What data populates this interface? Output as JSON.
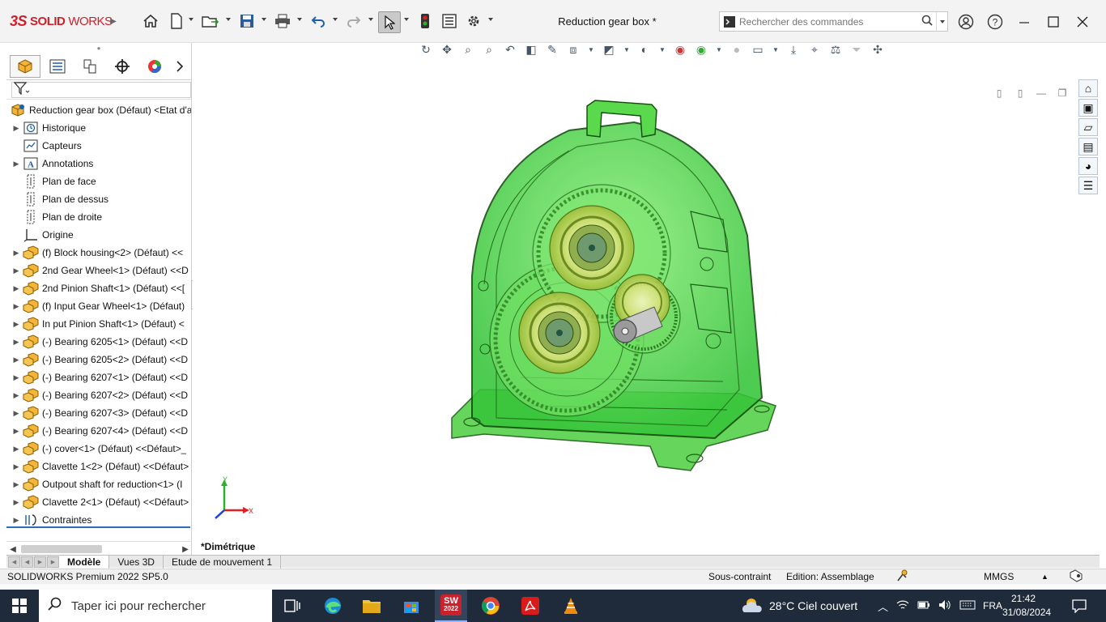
{
  "app": {
    "brand_prefix": "3S",
    "brand_solid": "SOLID",
    "brand_works": "WORKS",
    "document_title": "Reduction gear box *"
  },
  "search": {
    "placeholder": "Rechercher des commandes"
  },
  "toolbar_icons": [
    "home-icon",
    "new-document-icon",
    "open-icon",
    "save-icon",
    "print-icon",
    "undo-icon",
    "redo-icon",
    "select-icon",
    "rebuild-icon",
    "file-properties-icon",
    "options-icon"
  ],
  "feature_tree": {
    "root": "Reduction gear box (Défaut) <Etat d'a",
    "items": [
      {
        "label": "Historique",
        "icon": "history-icon",
        "expandable": true
      },
      {
        "label": "Capteurs",
        "icon": "sensor-icon",
        "expandable": false
      },
      {
        "label": "Annotations",
        "icon": "annotation-icon",
        "expandable": true
      },
      {
        "label": "Plan de face",
        "icon": "plane-icon",
        "expandable": false
      },
      {
        "label": "Plan de dessus",
        "icon": "plane-icon",
        "expandable": false
      },
      {
        "label": "Plan de droite",
        "icon": "plane-icon",
        "expandable": false
      },
      {
        "label": "Origine",
        "icon": "origin-icon",
        "expandable": false
      },
      {
        "label": "(f) Block housing<2> (Défaut) <<",
        "icon": "part-icon",
        "expandable": true
      },
      {
        "label": "2nd Gear Wheel<1> (Défaut) <<D",
        "icon": "part-icon",
        "expandable": true
      },
      {
        "label": "2nd Pinion Shaft<1> (Défaut) <<[",
        "icon": "part-icon",
        "expandable": true
      },
      {
        "label": "(f) Input Gear Wheel<1> (Défaut)",
        "icon": "part-icon",
        "expandable": true
      },
      {
        "label": "In put Pinion Shaft<1> (Défaut) <",
        "icon": "part-icon",
        "expandable": true
      },
      {
        "label": "(-) Bearing 6205<1> (Défaut) <<D",
        "icon": "part-icon",
        "expandable": true
      },
      {
        "label": "(-) Bearing 6205<2> (Défaut) <<D",
        "icon": "part-icon",
        "expandable": true
      },
      {
        "label": "(-) Bearing 6207<1> (Défaut) <<D",
        "icon": "part-icon",
        "expandable": true
      },
      {
        "label": "(-) Bearing 6207<2> (Défaut) <<D",
        "icon": "part-icon",
        "expandable": true
      },
      {
        "label": "(-) Bearing 6207<3> (Défaut) <<D",
        "icon": "part-icon",
        "expandable": true
      },
      {
        "label": "(-) Bearing 6207<4> (Défaut) <<D",
        "icon": "part-icon",
        "expandable": true
      },
      {
        "label": "(-) cover<1> (Défaut) <<Défaut>_",
        "icon": "part-icon",
        "expandable": true
      },
      {
        "label": "Clavette 1<2> (Défaut) <<Défaut>",
        "icon": "part-icon",
        "expandable": true
      },
      {
        "label": "Outpout shaft for reduction<1> (I",
        "icon": "part-icon",
        "expandable": true
      },
      {
        "label": "Clavette 2<1> (Défaut) <<Défaut>",
        "icon": "part-icon",
        "expandable": true
      },
      {
        "label": "Contraintes",
        "icon": "mates-icon",
        "expandable": true
      }
    ]
  },
  "viewport": {
    "view_name": "*Dimétrique",
    "axis_x": "X",
    "axis_y": "Y"
  },
  "bottom_tabs": [
    "Modèle",
    "Vues 3D",
    "Etude de mouvement 1"
  ],
  "status": {
    "product": "SOLIDWORKS Premium 2022 SP5.0",
    "constraint": "Sous-contraint",
    "mode": "Edition: Assemblage",
    "units": "MMGS",
    "units_caret": "▲"
  },
  "taskbar": {
    "search_placeholder": "Taper ici pour rechercher",
    "sw_badge": "2022",
    "weather": "28°C  Ciel couvert",
    "language": "FRA",
    "time": "21:42",
    "date": "31/08/2024"
  },
  "colors": {
    "accent_red": "#d0202b",
    "model_green": "#3fd43a",
    "taskbar": "#1f2b3a"
  }
}
